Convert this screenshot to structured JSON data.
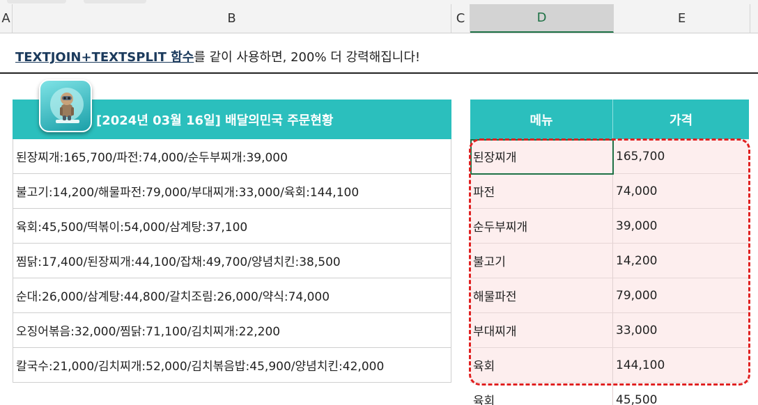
{
  "columns": [
    "A",
    "B",
    "C",
    "D",
    "E"
  ],
  "active_column": "D",
  "title": {
    "strong": "TEXTJOIN+TEXTSPLIT 함수",
    "rest": "를 같이 사용하면, 200% 더 강력해집니다!"
  },
  "left_table": {
    "header": "[2024년 03월 16일] 배달의민국 주문현황",
    "rows": [
      "된장찌개:165,700/파전:74,000/순두부찌개:39,000",
      "불고기:14,200/해물파전:79,000/부대찌개:33,000/육회:144,100",
      "육회:45,500/떡볶이:54,000/삼계탕:37,100",
      "찜닭:17,400/된장찌개:44,100/잡채:49,700/양념치킨:38,500",
      "순대:26,000/삼계탕:44,800/갈치조림:26,000/약식:74,000",
      "오징어볶음:32,000/찜닭:71,100/김치찌개:22,200",
      "칼국수:21,000/김치찌개:52,000/김치볶음밥:45,900/양념치킨:42,000"
    ]
  },
  "right_table": {
    "headers": [
      "메뉴",
      "가격"
    ],
    "rows": [
      {
        "menu": "된장찌개",
        "price": "165,700"
      },
      {
        "menu": "파전",
        "price": "74,000"
      },
      {
        "menu": "순두부찌개",
        "price": "39,000"
      },
      {
        "menu": "불고기",
        "price": "14,200"
      },
      {
        "menu": "해물파전",
        "price": "79,000"
      },
      {
        "menu": "부대찌개",
        "price": "33,000"
      },
      {
        "menu": "육회",
        "price": "144,100"
      },
      {
        "menu": "육회",
        "price": "45,500"
      }
    ]
  },
  "colors": {
    "header_teal": "#2bbfbd",
    "highlight_fill": "#fdeeee",
    "dashed_outline": "#e02020",
    "selection": "#1e7145"
  },
  "icons": {
    "logo": "robot-mascot-icon"
  }
}
